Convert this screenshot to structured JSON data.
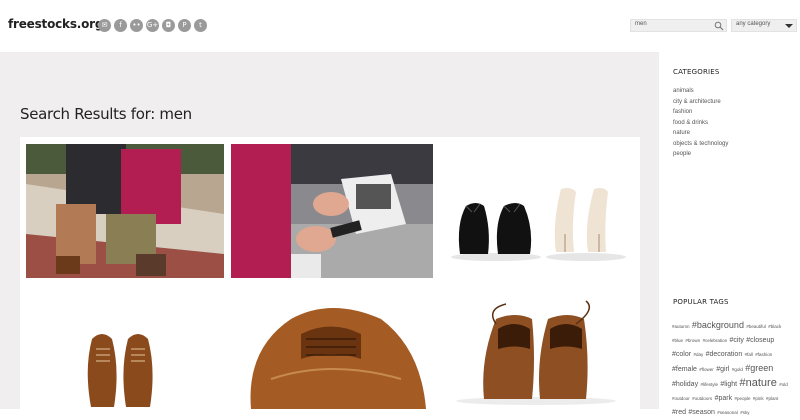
{
  "header": {
    "logo": "freestocks.org",
    "socials": [
      {
        "icon": "mail-icon",
        "glyph": "✉"
      },
      {
        "icon": "facebook-icon",
        "glyph": "f"
      },
      {
        "icon": "flickr-icon",
        "glyph": "••"
      },
      {
        "icon": "googleplus-icon",
        "glyph": "G+"
      },
      {
        "icon": "instagram-icon",
        "glyph": "◘"
      },
      {
        "icon": "pinterest-icon",
        "glyph": "P"
      },
      {
        "icon": "twitter-icon",
        "glyph": "t"
      }
    ],
    "search_value": "men",
    "category_select": "any category"
  },
  "main": {
    "title": "Search Results for: men",
    "results": [
      {
        "name": "men-on-bench-photo"
      },
      {
        "name": "man-reading-newspaper-photo"
      },
      {
        "name": "black-and-white-shoes-photo"
      },
      {
        "name": "brown-shoes-pair-photo"
      },
      {
        "name": "brown-shoe-closeup-photo"
      },
      {
        "name": "brown-shoes-back-photo"
      }
    ]
  },
  "sidebar": {
    "categories_heading": "CATEGORIES",
    "categories": [
      "animals",
      "city & architecture",
      "fashion",
      "food & drinks",
      "nature",
      "objects & technology",
      "people"
    ],
    "tags_heading": "POPULAR TAGS",
    "tags": [
      {
        "text": "#autumn",
        "size": "s"
      },
      {
        "text": "#background",
        "size": "l"
      },
      {
        "text": "#beautiful",
        "size": "s"
      },
      {
        "text": "#black",
        "size": "s"
      },
      {
        "text": "#blue",
        "size": "s"
      },
      {
        "text": "#brown",
        "size": "s"
      },
      {
        "text": "#celebration",
        "size": "s"
      },
      {
        "text": "#city",
        "size": "m"
      },
      {
        "text": "#closeup",
        "size": "m"
      },
      {
        "text": "#color",
        "size": "m"
      },
      {
        "text": "#day",
        "size": "s"
      },
      {
        "text": "#decoration",
        "size": "m"
      },
      {
        "text": "#fall",
        "size": "s"
      },
      {
        "text": "#fashion",
        "size": "s"
      },
      {
        "text": "#female",
        "size": "m"
      },
      {
        "text": "#flower",
        "size": "s"
      },
      {
        "text": "#girl",
        "size": "m"
      },
      {
        "text": "#gold",
        "size": "s"
      },
      {
        "text": "#green",
        "size": "l"
      },
      {
        "text": "#holiday",
        "size": "m"
      },
      {
        "text": "#lifestyle",
        "size": "s"
      },
      {
        "text": "#light",
        "size": "m"
      },
      {
        "text": "#nature",
        "size": "xl"
      },
      {
        "text": "#old",
        "size": "s"
      },
      {
        "text": "#outdoor",
        "size": "s"
      },
      {
        "text": "#outdoors",
        "size": "s"
      },
      {
        "text": "#park",
        "size": "m"
      },
      {
        "text": "#people",
        "size": "s"
      },
      {
        "text": "#pink",
        "size": "s"
      },
      {
        "text": "#plant",
        "size": "s"
      },
      {
        "text": "#red",
        "size": "m"
      },
      {
        "text": "#season",
        "size": "m"
      },
      {
        "text": "#seasonal",
        "size": "s"
      },
      {
        "text": "#sky",
        "size": "s"
      }
    ]
  }
}
